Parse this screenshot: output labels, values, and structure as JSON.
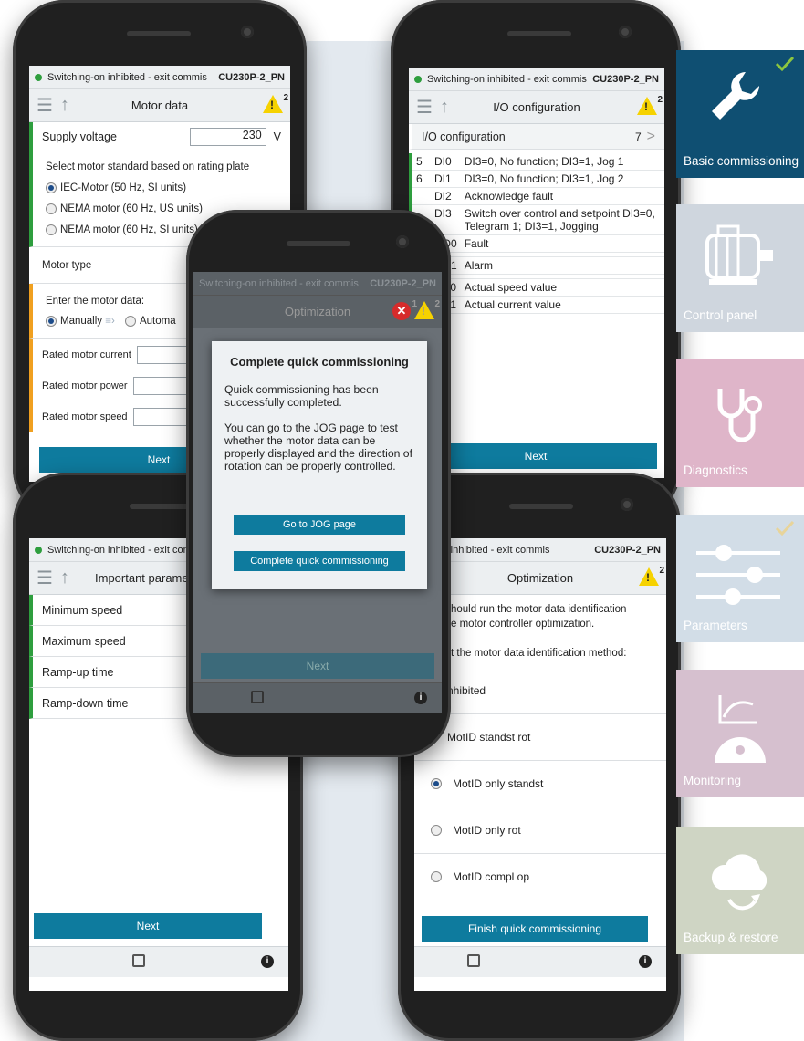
{
  "common": {
    "status": "Switching-on inhibited - exit commis",
    "device": "CU230P-2_PN",
    "warn_count": "2"
  },
  "phone_motor": {
    "title": "Motor data",
    "supply_label": "Supply voltage",
    "supply_value": "230",
    "supply_unit": "V",
    "standard_label": "Select motor standard based on rating plate",
    "std_options": [
      "IEC-Motor (50 Hz, SI units)",
      "NEMA motor (60 Hz, US units)",
      "NEMA motor (60 Hz, SI units)"
    ],
    "motor_type": "Motor type",
    "enter_label": "Enter the motor data:",
    "manually": "Manually",
    "automatic": "Automa",
    "current": "Rated motor current",
    "power": "Rated motor power",
    "speed": "Rated motor speed",
    "next": "Next"
  },
  "phone_io": {
    "title": "I/O configuration",
    "io_label": "I/O configuration",
    "io_count": "7",
    "rows": [
      [
        "5",
        "DI0",
        "DI3=0, No function; DI3=1, Jog 1"
      ],
      [
        "6",
        "DI1",
        "DI3=0, No function; DI3=1, Jog 2"
      ],
      [
        "",
        "DI2",
        "Acknowledge fault"
      ],
      [
        "",
        "DI3",
        "Switch over control and setpoint DI3=0, Telegram 1; DI3=1, Jogging"
      ],
      [
        "",
        "DO0",
        "Fault"
      ],
      [
        "",
        "",
        ""
      ],
      [
        "",
        "DO1",
        "Alarm"
      ],
      [
        "",
        "",
        ""
      ],
      [
        "",
        "AO0",
        "Actual speed value"
      ],
      [
        "",
        "AO1",
        "Actual current value"
      ]
    ],
    "next": "Next"
  },
  "phone_params": {
    "title": "Important paramete",
    "min": "Minimum speed",
    "max": "Maximum speed",
    "up": "Ramp-up time",
    "down": "Ramp-down time",
    "next": "Next"
  },
  "phone_opt": {
    "status": "ing-on inhibited - exit commis",
    "title": "Optimization",
    "intro1": "hould run the motor data identification",
    "intro2": "e motor controller optimization.",
    "choose": "t the motor data identification method:",
    "options": [
      "nhibited",
      "MotID standst rot",
      "MotID only standst",
      "MotID only rot",
      "MotID compl op"
    ],
    "finish": "Finish quick commissioning"
  },
  "dialog": {
    "bg_title": "Optimization",
    "err_count": "1",
    "heading": "Complete quick commissioning",
    "p1": "Quick commissioning has been successfully completed.",
    "p2": "You can go to the JOG page to test whether the motor data can be properly displayed and the direction of rotation can be properly controlled.",
    "btn_jog": "Go to JOG page",
    "btn_complete": "Complete quick commissioning",
    "next": "Next"
  },
  "tiles": [
    {
      "label": "Basic commissioning",
      "color": "#0f4f72"
    },
    {
      "label": "Control panel",
      "color": "#cfd6de"
    },
    {
      "label": "Diagnostics",
      "color": "#dfb5c9"
    },
    {
      "label": "Parameters",
      "color": "#d2dde7"
    },
    {
      "label": "Monitoring",
      "color": "#d6c0cf"
    },
    {
      "label": "Backup & restore",
      "color": "#cfd5c4"
    }
  ]
}
